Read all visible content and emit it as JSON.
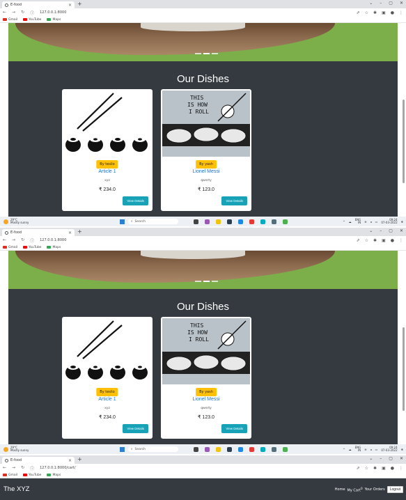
{
  "browser": {
    "tab_title": "E-food",
    "tab_close": "×",
    "new_tab": "+",
    "url": "127.0.0.1:8000",
    "url_cart": "127.0.0.1:8000/cart/",
    "bookmarks": [
      "Gmail",
      "YouTube",
      "Maps"
    ]
  },
  "section": {
    "title": "Our Dishes"
  },
  "cards": [
    {
      "by": "By teslio",
      "name": "Article 1",
      "desc": "xyz",
      "price": "₹ 234.0",
      "button": "View Details"
    },
    {
      "by": "By yash",
      "name": "Lionel Messi",
      "desc": "qwerty",
      "price": "₹ 123.0",
      "button": "View Details"
    }
  ],
  "comic_text": [
    "THIS",
    "IS HOW",
    "I ROLL"
  ],
  "taskbar": {
    "weather_temp": "29°C",
    "weather_desc": "Mostly sunny",
    "search": "Search",
    "lang": "ENG",
    "lang2": "IN",
    "time": "09:24",
    "date": "07-03-2022"
  },
  "navbar": {
    "brand": "The XYZ",
    "home": "Home",
    "cart": "My Cart",
    "cart_badge": "0",
    "orders": "Your Orders",
    "logout": "Logout"
  },
  "colors": {
    "dark_bg": "#343a40",
    "badge_yellow": "#ffc107",
    "button_teal": "#17a2b8",
    "hero_green": "#7cae4a"
  }
}
